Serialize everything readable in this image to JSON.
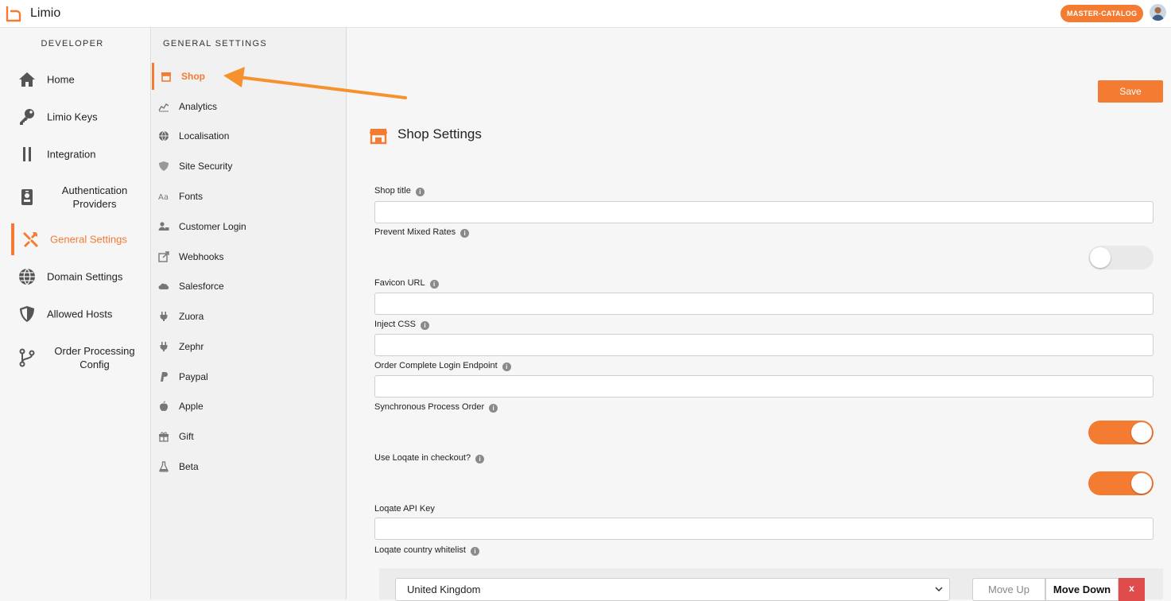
{
  "app": {
    "title": "Limio",
    "catalog_badge": "MASTER-CATALOG"
  },
  "colors": {
    "accent": "#f47b32",
    "danger": "#e04c4c"
  },
  "sidebar": {
    "heading": "DEVELOPER",
    "items": [
      {
        "label": "Home",
        "icon": "home-icon"
      },
      {
        "label": "Limio Keys",
        "icon": "key-icon"
      },
      {
        "label": "Integration",
        "icon": "integration-icon"
      },
      {
        "label": "Authentication Providers",
        "icon": "id-badge-icon"
      },
      {
        "label": "General Settings",
        "icon": "tools-icon",
        "active": true
      },
      {
        "label": "Domain Settings",
        "icon": "globe-icon"
      },
      {
        "label": "Allowed Hosts",
        "icon": "shield-icon"
      },
      {
        "label": "Order Processing Config",
        "icon": "branch-icon"
      }
    ]
  },
  "settings_nav": {
    "heading": "GENERAL SETTINGS",
    "items": [
      {
        "label": "Shop",
        "icon": "shop-icon",
        "active": true
      },
      {
        "label": "Analytics",
        "icon": "chart-icon"
      },
      {
        "label": "Localisation",
        "icon": "globe-icon"
      },
      {
        "label": "Site Security",
        "icon": "shield-icon"
      },
      {
        "label": "Fonts",
        "icon": "font-icon"
      },
      {
        "label": "Customer Login",
        "icon": "user-lock-icon"
      },
      {
        "label": "Webhooks",
        "icon": "external-link-icon"
      },
      {
        "label": "Salesforce",
        "icon": "cloud-icon"
      },
      {
        "label": "Zuora",
        "icon": "plug-icon"
      },
      {
        "label": "Zephr",
        "icon": "plug-icon"
      },
      {
        "label": "Paypal",
        "icon": "paypal-icon"
      },
      {
        "label": "Apple",
        "icon": "apple-icon"
      },
      {
        "label": "Gift",
        "icon": "gift-icon"
      },
      {
        "label": "Beta",
        "icon": "flask-icon"
      }
    ]
  },
  "main": {
    "save_label": "Save",
    "section_title": "Shop Settings",
    "fields": {
      "shop_title": {
        "label": "Shop title",
        "value": ""
      },
      "prevent_mixed_rates": {
        "label": "Prevent Mixed Rates",
        "enabled": false
      },
      "favicon_url": {
        "label": "Favicon URL",
        "value": ""
      },
      "inject_css": {
        "label": "Inject CSS",
        "value": ""
      },
      "order_complete_login_endpoint": {
        "label": "Order Complete Login Endpoint",
        "value": ""
      },
      "synchronous_process_order": {
        "label": "Synchronous Process Order",
        "enabled": true
      },
      "use_loqate": {
        "label": "Use Loqate in checkout?",
        "enabled": true
      },
      "loqate_api_key": {
        "label": "Loqate API Key",
        "value": ""
      },
      "loqate_country_whitelist": {
        "label": "Loqate country whitelist"
      }
    },
    "whitelist": {
      "selected_country": "United Kingdom",
      "move_up_label": "Move Up",
      "move_down_label": "Move Down",
      "remove_label": "x"
    }
  }
}
